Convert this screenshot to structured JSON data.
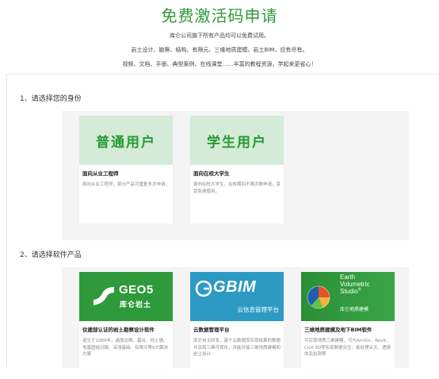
{
  "header": {
    "title": "免费激活码申请",
    "subtitle_line1": "库仑公司旗下所有产品均可以免费试用。",
    "subtitle_line2": "岩土设计、勘察、结构、有限元、三维地质建模、岩土BIM，应有尽有。",
    "subtitle_line3": "视频、文档、手册、典型案例、在线课堂……丰富的教程资源，学起来更省心！"
  },
  "identity_section": {
    "label": "1、请选择您的身份",
    "cards": [
      {
        "banner": "普通用户",
        "title": "面向从业工程师",
        "desc": "面向从业工程师，部分产品可重复多次申请。"
      },
      {
        "banner": "学生用户",
        "title": "面向在校大学生",
        "desc": "面向在校大学生，在校期间不限次数申请，享受免费使用。"
      }
    ]
  },
  "product_section": {
    "label": "2、请选择软件产品",
    "cards": [
      {
        "logo_main": "GEO5",
        "logo_sub": "库仑岩土",
        "title": "住建部认证的岩土勘察设计软件",
        "desc": "诞生于1989年，涵盖边坡、基坑、挡土墙、地基固结沉降、深浅基础、有限元等9大解决方案"
      },
      {
        "logo_main": "GBIM",
        "logo_sub": "云信息管理平台",
        "title": "云数据管理平台",
        "desc": "库仑自主研发，基于云数据库实现成果的数据共享和三维可视化，并能对接三维地质建模和岩土设计"
      },
      {
        "logo_line1": "Earth",
        "logo_line2": "Volumetric",
        "logo_line3": "Studio",
        "logo_tm": "®",
        "logo_sub": "库仑地质建模",
        "title": "三维地质建模及地下BIM软件",
        "desc": "可实现地质三维建模，可与ArcGis、Revit、Civil 3D等实现数据交互；能处理尖灭、透镜体及岩洞等"
      }
    ]
  },
  "colors": {
    "brand_green": "#2e9a38",
    "banner_light_green": "#d4ebd7",
    "gbim_blue": "#2c9ac2"
  }
}
